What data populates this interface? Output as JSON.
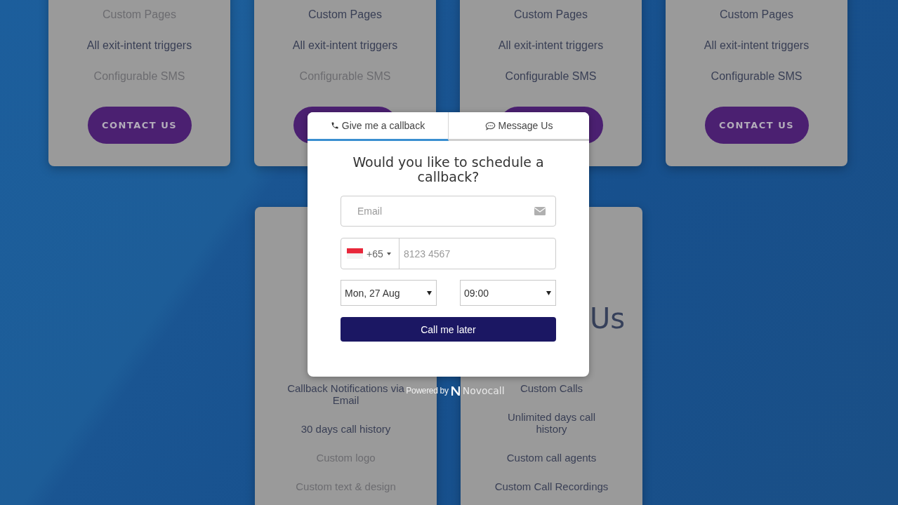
{
  "top_cards": [
    {
      "features": [
        {
          "text": "Custom Pages",
          "enabled": false
        },
        {
          "text": "All exit-intent triggers",
          "enabled": true
        },
        {
          "text": "Configurable SMS",
          "enabled": false
        }
      ],
      "action": {
        "kind": "pill",
        "label": "CONTACT US"
      }
    },
    {
      "features": [
        {
          "text": "Custom Pages",
          "enabled": true
        },
        {
          "text": "All exit-intent triggers",
          "enabled": true
        },
        {
          "text": "Configurable SMS",
          "enabled": false
        }
      ],
      "action": {
        "kind": "pill"
      }
    },
    {
      "features": [
        {
          "text": "Custom Pages",
          "enabled": true
        },
        {
          "text": "All exit-intent triggers",
          "enabled": true
        },
        {
          "text": "Configurable SMS",
          "enabled": true
        }
      ],
      "action": {
        "kind": "pill"
      }
    },
    {
      "features": [
        {
          "text": "Custom Pages",
          "enabled": true
        },
        {
          "text": "All exit-intent triggers",
          "enabled": true
        },
        {
          "text": "Configurable SMS",
          "enabled": true
        }
      ],
      "action": {
        "kind": "pill",
        "label": "CONTACT US"
      }
    }
  ],
  "bottom_cards": [
    {
      "features": [
        {
          "text": "Callback Notifications via Email",
          "enabled": true
        },
        {
          "text": "30 days call history",
          "enabled": true
        },
        {
          "text": "Custom logo",
          "enabled": false
        },
        {
          "text": "Custom text & design",
          "enabled": false
        }
      ]
    },
    {
      "heading": "Us",
      "features": [
        {
          "text": "Custom Calls",
          "enabled": true
        },
        {
          "text": "Unlimited days call history",
          "enabled": true
        },
        {
          "text": "Custom call agents",
          "enabled": true
        },
        {
          "text": "Custom Call Recordings",
          "enabled": true
        }
      ]
    }
  ],
  "modal": {
    "tabs": [
      {
        "kind": "callback",
        "label": "Give me a callback",
        "selected": true
      },
      {
        "kind": "message",
        "label": "Message Us",
        "selected": false
      }
    ],
    "title": "Would you like to schedule a callback?",
    "email": {
      "placeholder": "Email"
    },
    "phone": {
      "country_code": "+65",
      "placeholder": "8123 4567"
    },
    "date": {
      "value": "Mon, 27 Aug"
    },
    "time": {
      "value": "09:00"
    },
    "submit": "Call me later"
  },
  "footer": {
    "powered_by": "Powered by",
    "brand": "Novocall"
  }
}
